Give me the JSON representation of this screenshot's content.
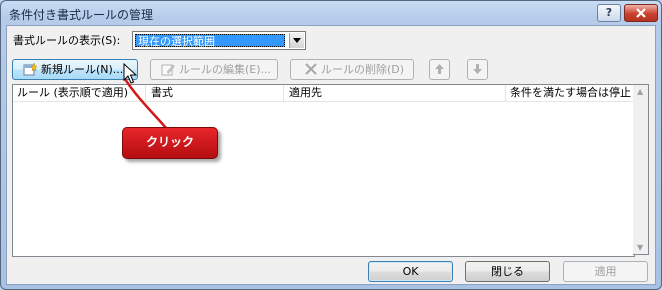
{
  "window": {
    "title": "条件付き書式ルールの管理",
    "help_label": "?",
    "close_label": "X"
  },
  "show_rules": {
    "label": "書式ルールの表示(S):",
    "selected_value": "現在の選択範囲"
  },
  "toolbar": {
    "new_rule": "新規ルール(N)...",
    "edit_rule": "ルールの編集(E)...",
    "delete_rule": "ルールの削除(D)"
  },
  "list": {
    "columns": [
      "ルール (表示順で適用)",
      "書式",
      "適用先",
      "条件を満たす場合は停止"
    ]
  },
  "footer": {
    "ok": "OK",
    "close": "閉じる",
    "apply": "適用"
  },
  "annotation": {
    "callout_text": "クリック"
  },
  "colors": {
    "callout": "#d4181b",
    "selection": "#3399ff",
    "close_button": "#c9412e"
  }
}
